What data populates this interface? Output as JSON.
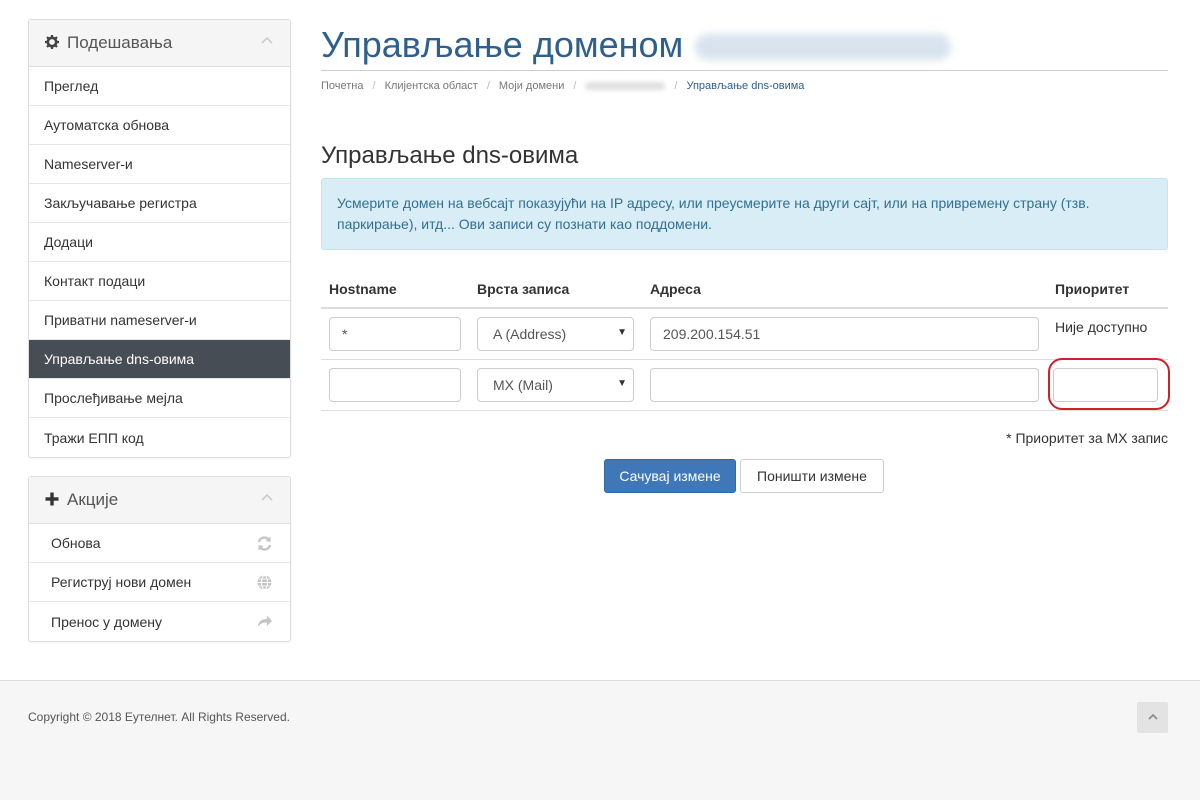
{
  "sidebar": {
    "settings": {
      "title": "Подешавања",
      "items": [
        {
          "label": "Преглед"
        },
        {
          "label": "Аутоматска обнова"
        },
        {
          "label": "Nameserver-и"
        },
        {
          "label": "Закључавање регистра"
        },
        {
          "label": "Додаци"
        },
        {
          "label": "Контакт подаци"
        },
        {
          "label": "Приватни nameserver-и"
        },
        {
          "label": "Управљање dns-овима",
          "active": true
        },
        {
          "label": "Прослеђивање мејла"
        },
        {
          "label": "Тражи ЕПП код"
        }
      ]
    },
    "actions": {
      "title": "Акције",
      "items": [
        {
          "label": "Обнова",
          "icon": "refresh-icon"
        },
        {
          "label": "Региструј нови домен",
          "icon": "globe-icon"
        },
        {
          "label": "Пренос у домену",
          "icon": "share-arrow-icon"
        }
      ]
    }
  },
  "header": {
    "title": "Управљање доменом"
  },
  "breadcrumb": {
    "home": "Почетна",
    "client_area": "Клијентска област",
    "my_domains": "Моји домени",
    "current": "Управљање dns-овима"
  },
  "section": {
    "title": "Управљање dns-овима",
    "info": "Усмерите домен на вебсајт показујући на IP адресу, или преусмерите на други сајт, или на привремену страну (тзв. паркирање), итд... Ови записи су познати као поддомени."
  },
  "table": {
    "headers": {
      "hostname": "Hostname",
      "type": "Врста записа",
      "address": "Адреса",
      "priority": "Приоритет"
    },
    "rows": [
      {
        "hostname": "*",
        "type": "A (Address)",
        "address": "209.200.154.51",
        "priority": "Није доступно"
      },
      {
        "hostname": "",
        "type": "MX (Mail)",
        "address": "",
        "priority": ""
      }
    ]
  },
  "note": "* Приоритет за MX запис",
  "buttons": {
    "save": "Сачувај измене",
    "cancel": "Поништи измене"
  },
  "footer": {
    "copyright": "Copyright © 2018 Еутелнет. All Rights Reserved."
  },
  "colors": {
    "brand": "#2d5f8f",
    "active_menu": "#474d55",
    "primary_button": "#3f77b9",
    "alert_bg": "#d9edf7",
    "highlight": "#d0202a"
  }
}
